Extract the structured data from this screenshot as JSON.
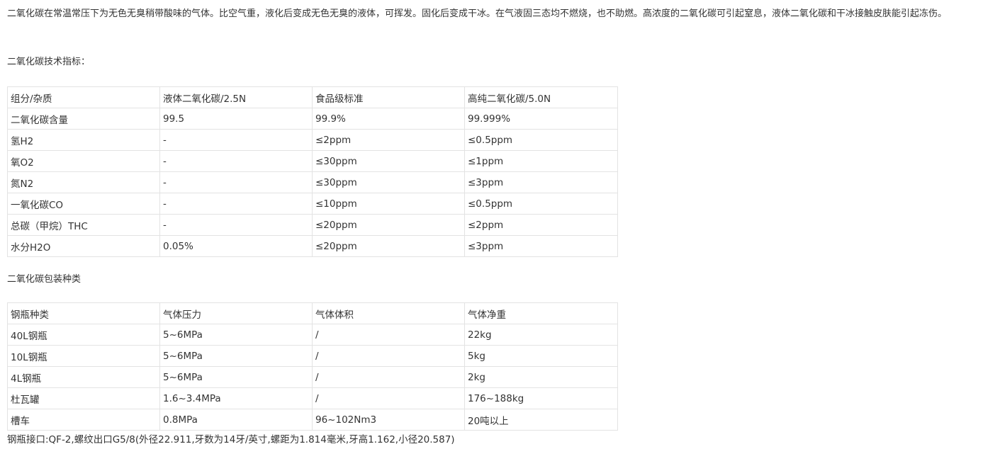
{
  "intro": "二氧化碳在常温常压下为无色无臭稍带酸味的气体。比空气重，液化后变成无色无臭的液体，可挥发。固化后变成干冰。在气液固三态均不燃烧，也不助燃。高浓度的二氧化碳可引起窒息，液体二氧化碳和干冰接触皮肤能引起冻伤。",
  "spec_heading": "二氧化碳技术指标：",
  "spec_table": {
    "headers": [
      "组分/杂质",
      "液体二氧化碳/2.5N",
      "食品级标准",
      "高纯二氧化碳/5.0N"
    ],
    "rows": [
      [
        "二氧化碳含量",
        "99.5",
        "99.9%",
        "99.999%"
      ],
      [
        "氢H2",
        "-",
        "≤2ppm",
        "≤0.5ppm"
      ],
      [
        "氧O2",
        "-",
        "≤30ppm",
        "≤1ppm"
      ],
      [
        "氮N2",
        "-",
        "≤30ppm",
        "≤3ppm"
      ],
      [
        "一氧化碳CO",
        "-",
        "≤10ppm",
        "≤0.5ppm"
      ],
      [
        "总碳（甲烷）THC",
        "-",
        "≤20ppm",
        "≤2ppm"
      ],
      [
        "水分H2O",
        "0.05%",
        "≤20ppm",
        "≤3ppm"
      ]
    ]
  },
  "package_heading": "二氧化碳包装种类",
  "package_table": {
    "headers": [
      "钢瓶种类",
      "气体压力",
      "气体体积",
      "气体净重"
    ],
    "rows": [
      [
        "40L钢瓶",
        "5~6MPa",
        "/",
        "22kg"
      ],
      [
        "10L钢瓶",
        "5~6MPa",
        "/",
        "5kg"
      ],
      [
        "4L钢瓶",
        "5~6MPa",
        "/",
        "2kg"
      ],
      [
        "杜瓦罐",
        "1.6~3.4MPa",
        "/",
        "176~188kg"
      ],
      [
        "槽车",
        "0.8MPa",
        "96~102Nm3",
        "20吨以上"
      ]
    ]
  },
  "footnote": "钢瓶接口:QF-2,螺纹出口G5/8(外径22.911,牙数为14牙/英寸,螺距为1.814毫米,牙高1.162,小径20.587)"
}
